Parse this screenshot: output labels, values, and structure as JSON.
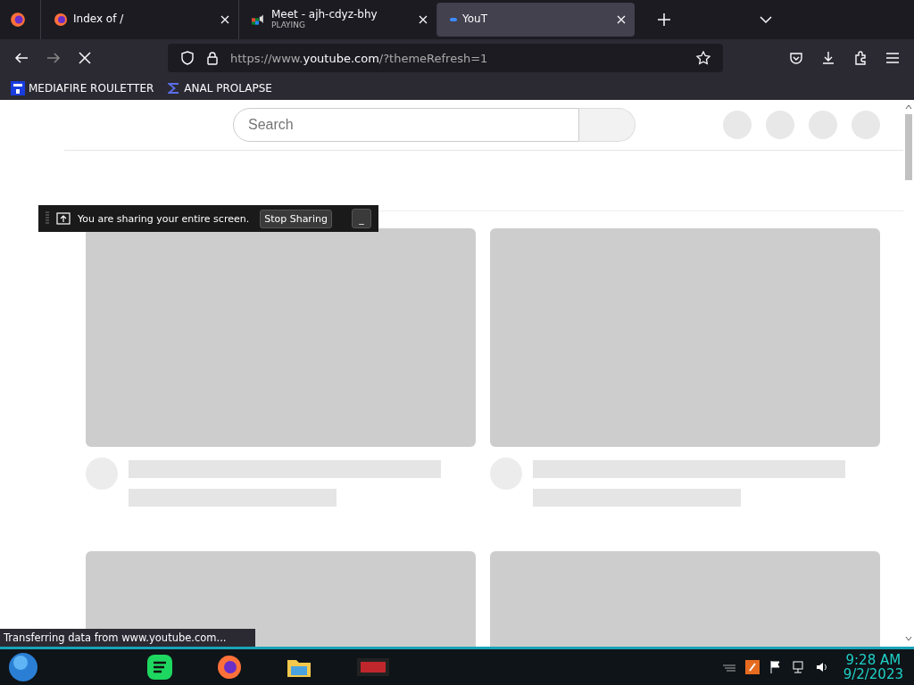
{
  "tabs": [
    {
      "title": "Index of /",
      "selected": false,
      "kind": "firefox"
    },
    {
      "title": "Meet - ajh-cdyz-bhy",
      "subtitle": "PLAYING",
      "selected": false,
      "kind": "meet"
    },
    {
      "title": "YouT",
      "selected": true,
      "kind": "loading"
    }
  ],
  "address": {
    "prefix": "https://www.",
    "domain": "youtube.com",
    "suffix": "/?themeRefresh=1"
  },
  "bookmarks": [
    {
      "label": "MEDIAFIRE ROULETTER",
      "kind": "square"
    },
    {
      "label": "ANAL PROLAPSE",
      "kind": "sigma"
    }
  ],
  "page": {
    "search": {
      "placeholder": "Search"
    },
    "videos": [
      {
        "kind": "loading"
      },
      {
        "kind": "loading"
      },
      {
        "kind": "thumb-only"
      },
      {
        "kind": "thumb-only"
      }
    ]
  },
  "sharing_bar": {
    "message": "You are sharing your entire screen.",
    "stop_button": "Stop Sharing",
    "minimize_button": "_"
  },
  "status_bar": "Transferring data from www.youtube.com...",
  "taskbar": {
    "time": "9:28 AM",
    "date": "9/2/2023"
  }
}
